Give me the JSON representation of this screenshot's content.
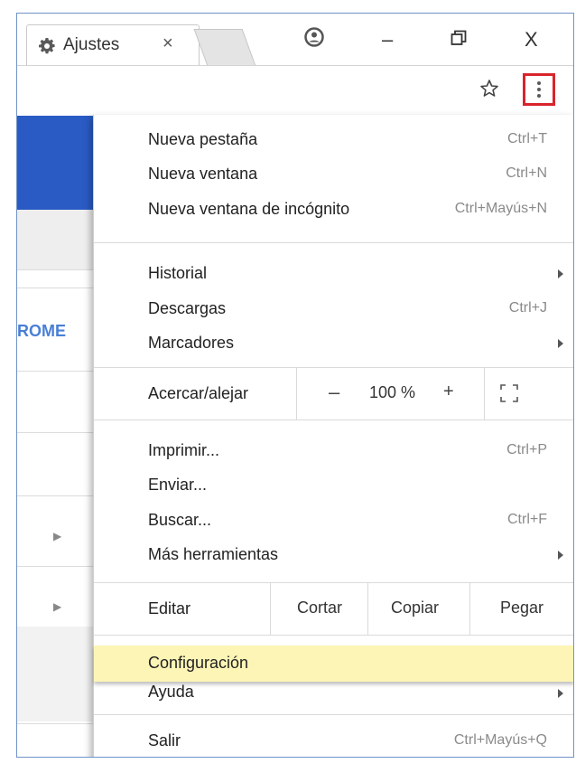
{
  "tab": {
    "title": "Ajustes",
    "close": "×",
    "settings_icon": "gear-icon"
  },
  "window_controls": {
    "minimize": "–",
    "close": "X",
    "profile_icon": "profile-icon",
    "restore_icon": "restore-icon"
  },
  "toolbar": {
    "bookmark_icon": "star-icon",
    "menu_icon": "three-dots-vertical-icon",
    "accent": "#d9242c"
  },
  "background": {
    "partial_text": "ROME",
    "accent": "#2a5bc4"
  },
  "menu": {
    "section1": [
      {
        "label": "Nueva pestaña",
        "shortcut": "Ctrl+T"
      },
      {
        "label": "Nueva ventana",
        "shortcut": "Ctrl+N"
      },
      {
        "label": "Nueva ventana de incógnito",
        "shortcut": "Ctrl+Mayús+N"
      }
    ],
    "section2": [
      {
        "label": "Historial",
        "shortcut": ""
      },
      {
        "label": "Descargas",
        "shortcut": "Ctrl+J"
      },
      {
        "label": "Marcadores",
        "shortcut": ""
      }
    ],
    "zoom": {
      "label": "Acercar/alejar",
      "minus": "–",
      "value": "100 %",
      "plus": "+",
      "fullscreen_icon": "fullscreen-icon"
    },
    "section4": [
      {
        "label": "Imprimir...",
        "shortcut": "Ctrl+P"
      },
      {
        "label": "Enviar...",
        "shortcut": ""
      },
      {
        "label": "Buscar...",
        "shortcut": "Ctrl+F"
      },
      {
        "label": "Más herramientas",
        "shortcut": ""
      }
    ],
    "edit": {
      "label": "Editar",
      "cut": "Cortar",
      "copy": "Copiar",
      "paste": "Pegar"
    },
    "settings": {
      "label": "Configuración",
      "highlight": "#fdf5b6"
    },
    "help": {
      "label": "Ayuda"
    },
    "exit": {
      "label": "Salir",
      "shortcut": "Ctrl+Mayús+Q"
    }
  }
}
